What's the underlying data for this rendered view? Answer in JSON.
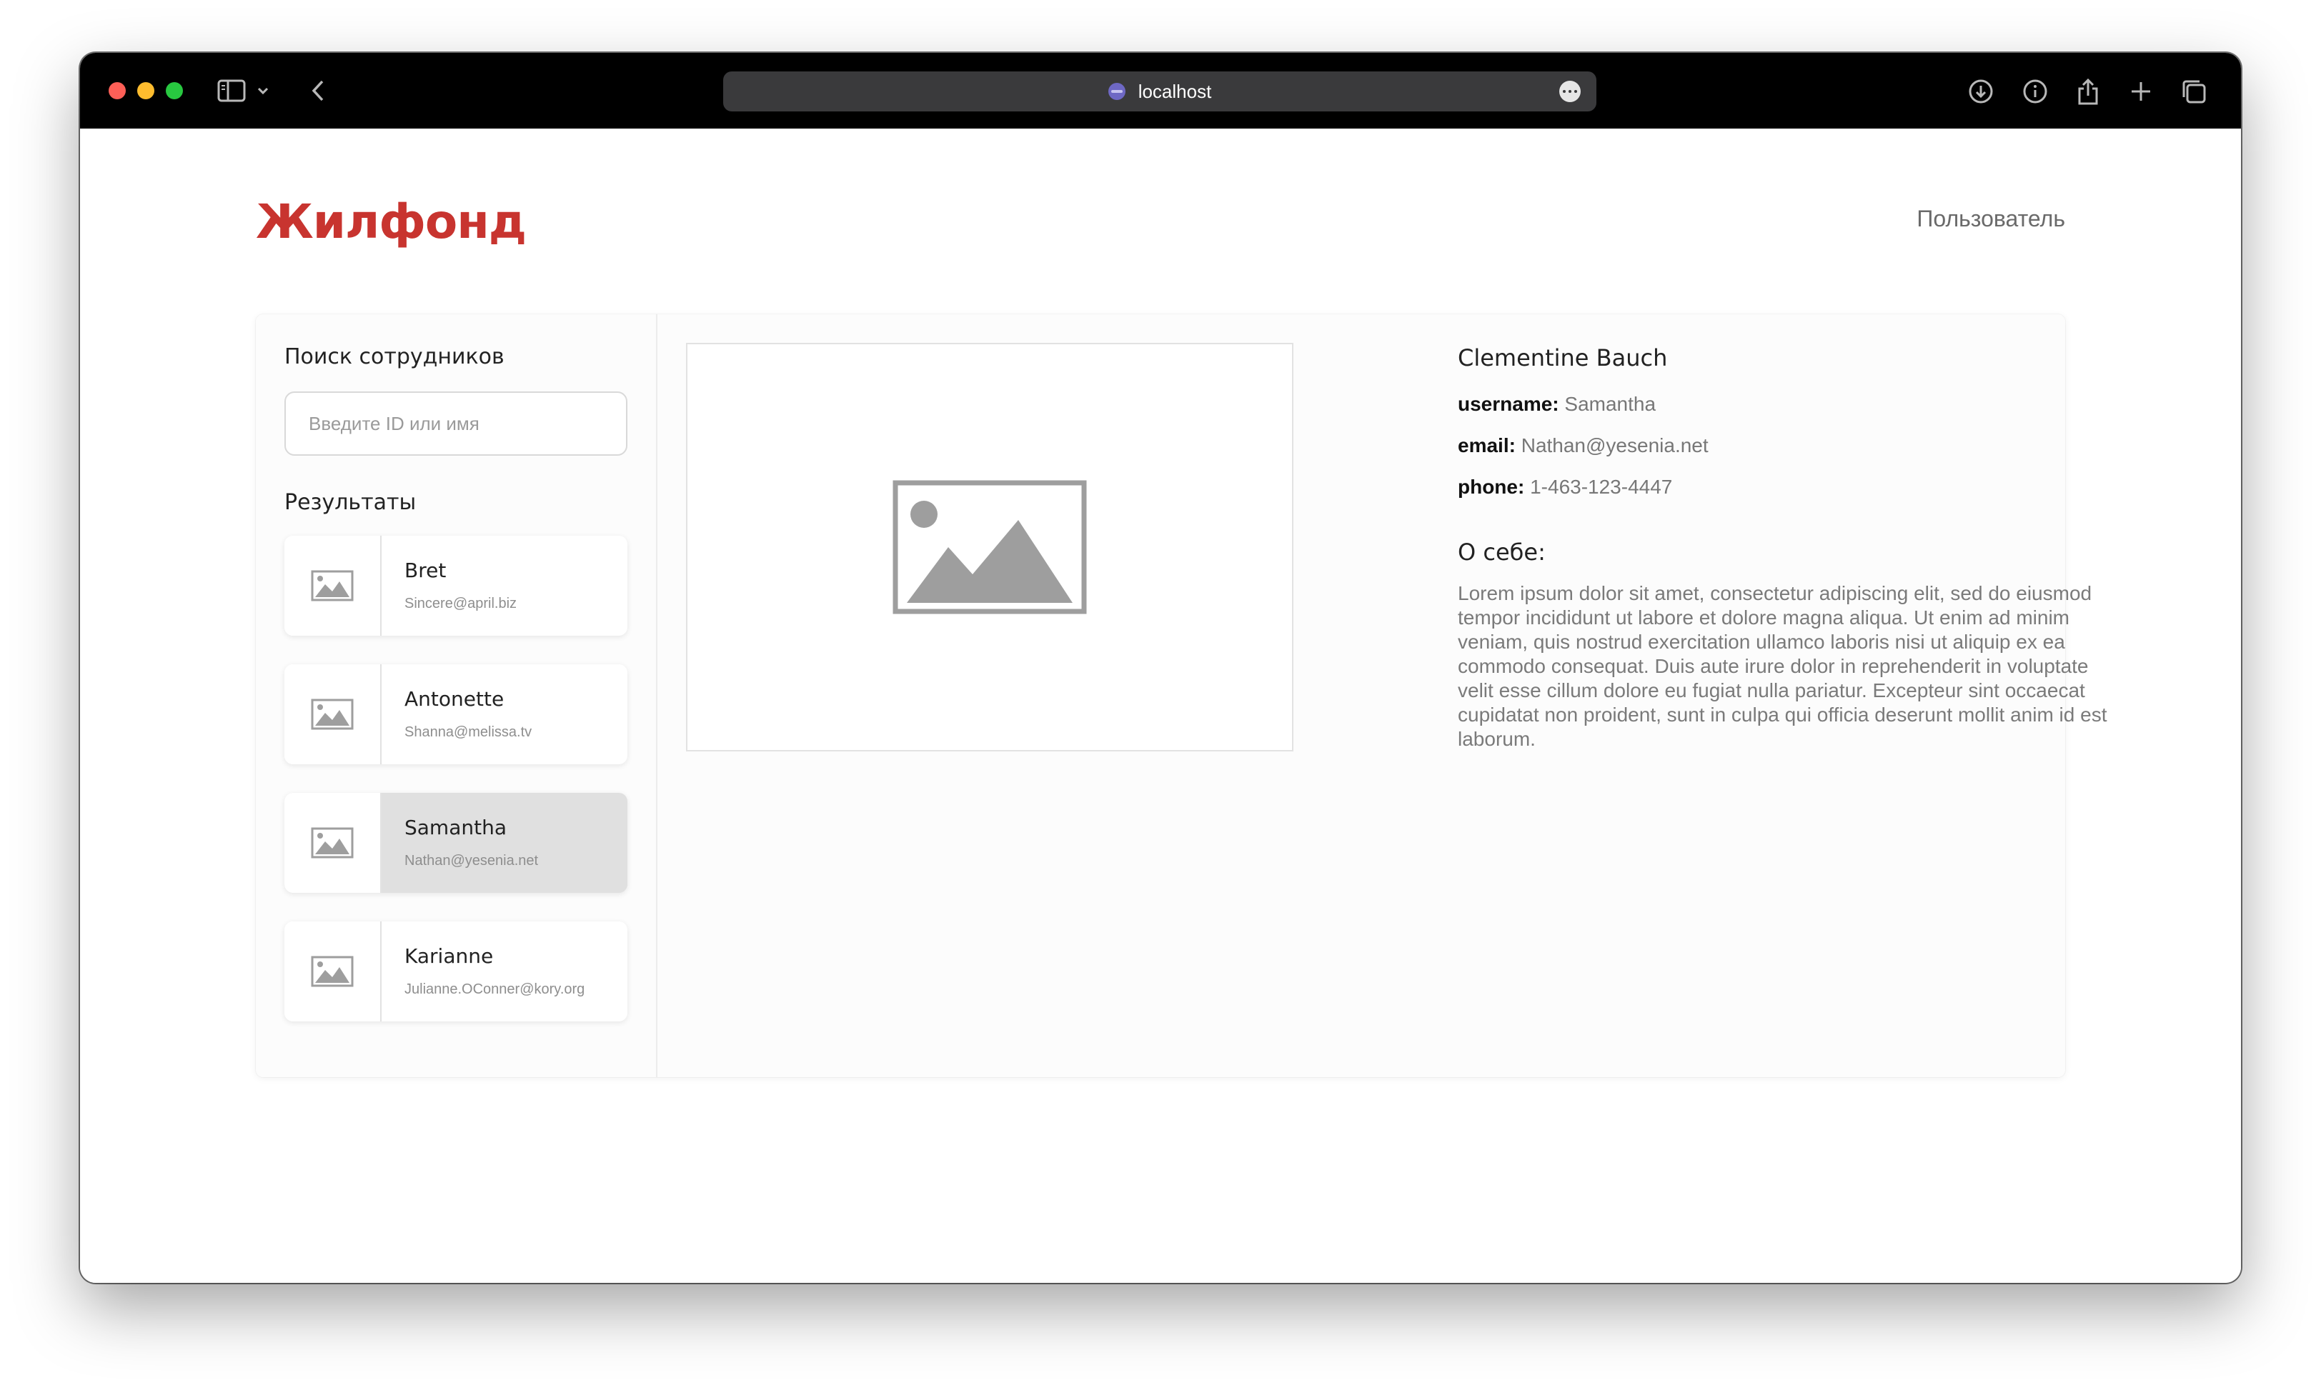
{
  "browser": {
    "url": "localhost",
    "colors": {
      "close": "#fe5f57",
      "minimize": "#febc2e",
      "maximize": "#28c840"
    }
  },
  "header": {
    "logo": "Жилфонд",
    "user_link": "Пользователь",
    "logo_color": "#c8342f"
  },
  "search": {
    "title": "Поиск сотрудников",
    "placeholder": "Введите ID или имя"
  },
  "results": {
    "title": "Результаты",
    "items": [
      {
        "name": "Bret",
        "email": "Sincere@april.biz",
        "selected": false
      },
      {
        "name": "Antonette",
        "email": "Shanna@melissa.tv",
        "selected": false
      },
      {
        "name": "Samantha",
        "email": "Nathan@yesenia.net",
        "selected": true
      },
      {
        "name": "Karianne",
        "email": "Julianne.OConner@kory.org",
        "selected": false
      }
    ]
  },
  "profile": {
    "name": "Clementine Bauch",
    "username_label": "username:",
    "username": "Samantha",
    "email_label": "email:",
    "email": "Nathan@yesenia.net",
    "phone_label": "phone:",
    "phone": "1-463-123-4447",
    "about_title": "О себе:",
    "about_text": "Lorem ipsum dolor sit amet, consectetur adipiscing elit, sed do eiusmod tempor incididunt ut labore et dolore magna aliqua. Ut enim ad minim veniam, quis nostrud exercitation ullamco laboris nisi ut aliquip ex ea commodo consequat. Duis aute irure dolor in reprehenderit in voluptate velit esse cillum dolore eu fugiat nulla pariatur. Excepteur sint occaecat cupidatat non proident, sunt in culpa qui officia deserunt mollit anim id est laborum."
  }
}
